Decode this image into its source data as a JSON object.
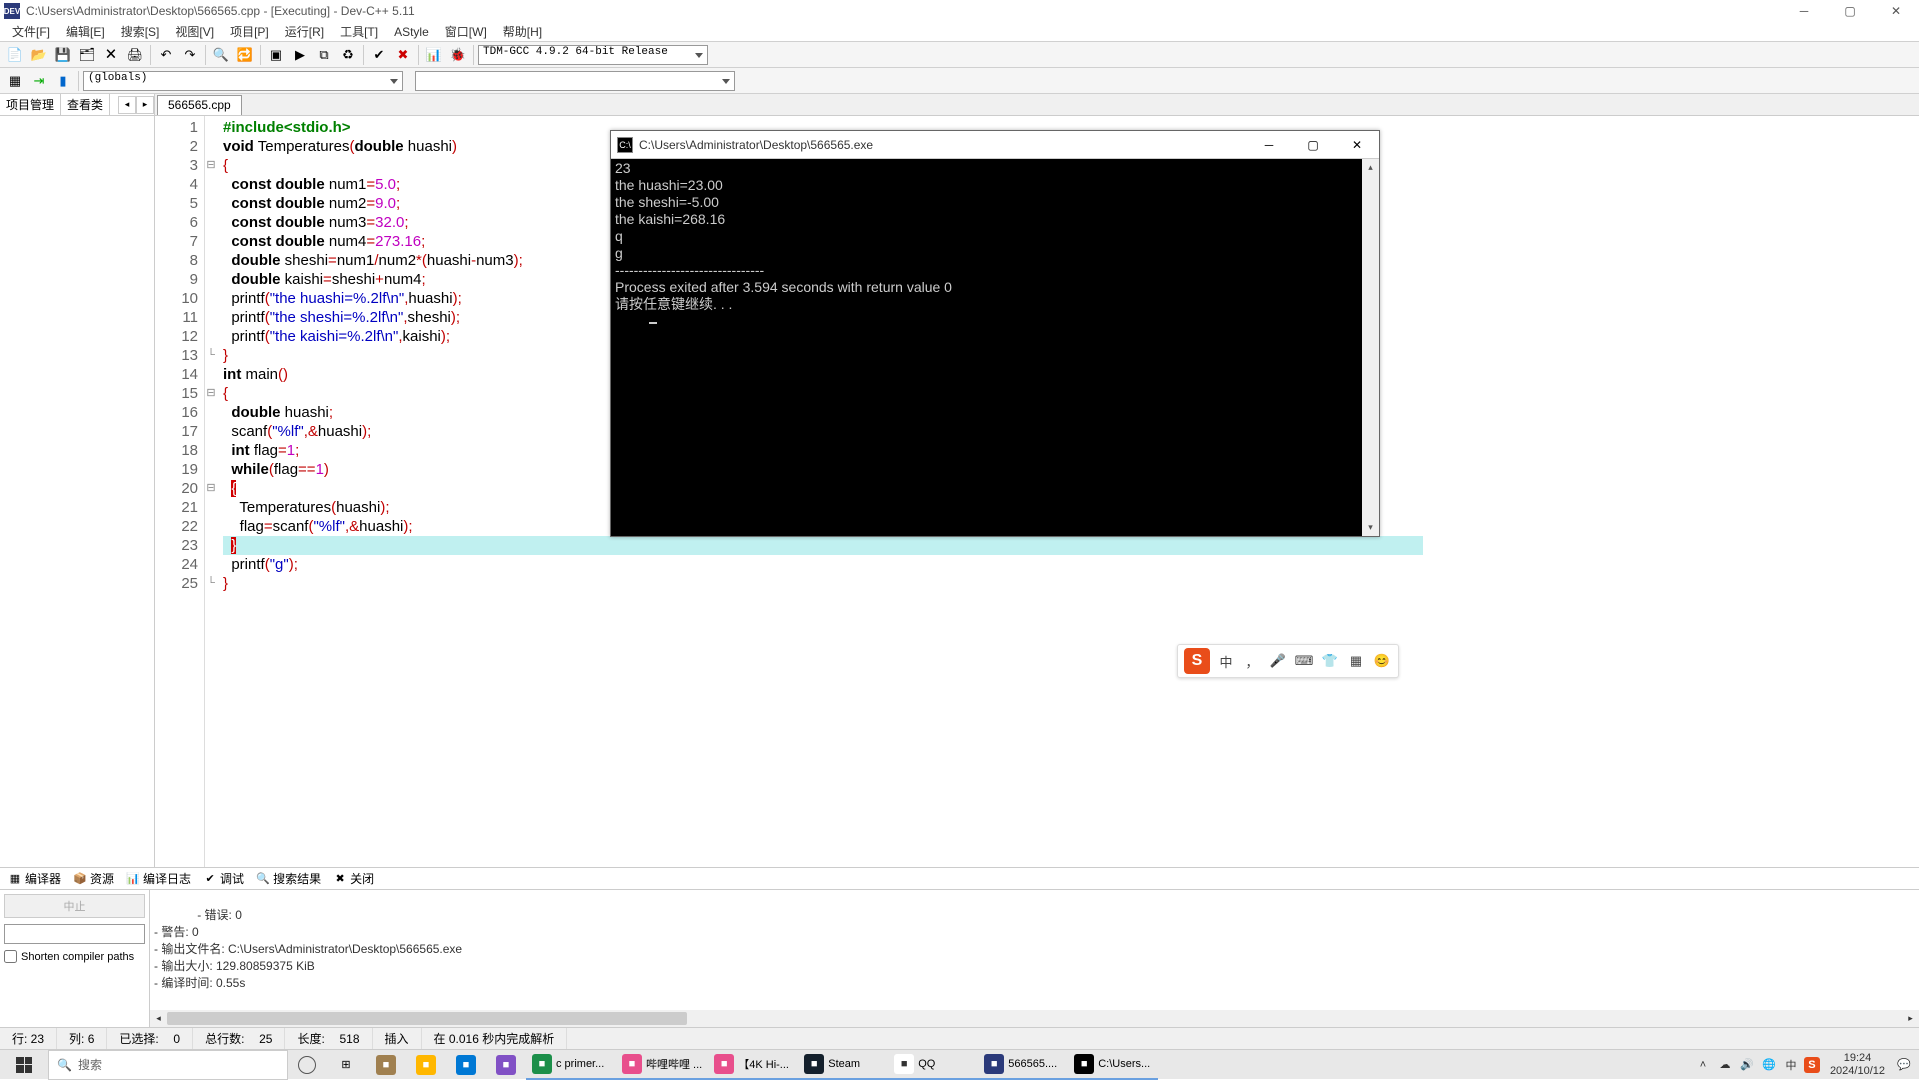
{
  "window": {
    "title": "C:\\Users\\Administrator\\Desktop\\566565.cpp - [Executing] - Dev-C++ 5.11"
  },
  "menus": [
    "文件[F]",
    "编辑[E]",
    "搜索[S]",
    "视图[V]",
    "项目[P]",
    "运行[R]",
    "工具[T]",
    "AStyle",
    "窗口[W]",
    "帮助[H]"
  ],
  "toolbar": {
    "globals": "(globals)",
    "compiler": "TDM-GCC 4.9.2 64-bit Release"
  },
  "sidebar": {
    "tabs": [
      "项目管理",
      "查看类"
    ]
  },
  "editor": {
    "tab": "566565.cpp",
    "lines": [
      {
        "n": 1,
        "fold": "",
        "t": [
          {
            "c": "pp",
            "s": "#include"
          },
          {
            "c": "pp",
            "s": "<stdio.h>"
          }
        ]
      },
      {
        "n": 2,
        "fold": "",
        "t": [
          {
            "c": "kw",
            "s": "void"
          },
          {
            "s": " Temperatures"
          },
          {
            "c": "pun",
            "s": "("
          },
          {
            "c": "kw",
            "s": "double"
          },
          {
            "s": " huashi"
          },
          {
            "c": "pun",
            "s": ")"
          }
        ]
      },
      {
        "n": 3,
        "fold": "⊟",
        "indent": 0,
        "t": [
          {
            "c": "pun",
            "s": "{"
          }
        ]
      },
      {
        "n": 4,
        "indent": 2,
        "t": [
          {
            "c": "kw",
            "s": "const"
          },
          {
            "s": " "
          },
          {
            "c": "kw",
            "s": "double"
          },
          {
            "s": " num1"
          },
          {
            "c": "pun",
            "s": "="
          },
          {
            "c": "num",
            "s": "5.0"
          },
          {
            "c": "pun",
            "s": ";"
          }
        ]
      },
      {
        "n": 5,
        "indent": 2,
        "t": [
          {
            "c": "kw",
            "s": "const"
          },
          {
            "s": " "
          },
          {
            "c": "kw",
            "s": "double"
          },
          {
            "s": " num2"
          },
          {
            "c": "pun",
            "s": "="
          },
          {
            "c": "num",
            "s": "9.0"
          },
          {
            "c": "pun",
            "s": ";"
          }
        ]
      },
      {
        "n": 6,
        "indent": 2,
        "t": [
          {
            "c": "kw",
            "s": "const"
          },
          {
            "s": " "
          },
          {
            "c": "kw",
            "s": "double"
          },
          {
            "s": " num3"
          },
          {
            "c": "pun",
            "s": "="
          },
          {
            "c": "num",
            "s": "32.0"
          },
          {
            "c": "pun",
            "s": ";"
          }
        ]
      },
      {
        "n": 7,
        "indent": 2,
        "t": [
          {
            "c": "kw",
            "s": "const"
          },
          {
            "s": " "
          },
          {
            "c": "kw",
            "s": "double"
          },
          {
            "s": " num4"
          },
          {
            "c": "pun",
            "s": "="
          },
          {
            "c": "num",
            "s": "273.16"
          },
          {
            "c": "pun",
            "s": ";"
          }
        ]
      },
      {
        "n": 8,
        "indent": 2,
        "t": [
          {
            "c": "kw",
            "s": "double"
          },
          {
            "s": " sheshi"
          },
          {
            "c": "pun",
            "s": "="
          },
          {
            "s": "num1"
          },
          {
            "c": "pun",
            "s": "/"
          },
          {
            "s": "num2"
          },
          {
            "c": "pun",
            "s": "*("
          },
          {
            "s": "huashi"
          },
          {
            "c": "pun",
            "s": "-"
          },
          {
            "s": "num3"
          },
          {
            "c": "pun",
            "s": ");"
          }
        ]
      },
      {
        "n": 9,
        "indent": 2,
        "t": [
          {
            "c": "kw",
            "s": "double"
          },
          {
            "s": " kaishi"
          },
          {
            "c": "pun",
            "s": "="
          },
          {
            "s": "sheshi"
          },
          {
            "c": "pun",
            "s": "+"
          },
          {
            "s": "num4"
          },
          {
            "c": "pun",
            "s": ";"
          }
        ]
      },
      {
        "n": 10,
        "indent": 2,
        "t": [
          {
            "s": "printf"
          },
          {
            "c": "pun",
            "s": "("
          },
          {
            "c": "str",
            "s": "\"the huashi=%.2lf\\n\""
          },
          {
            "c": "pun",
            "s": ","
          },
          {
            "s": "huashi"
          },
          {
            "c": "pun",
            "s": ");"
          }
        ]
      },
      {
        "n": 11,
        "indent": 2,
        "t": [
          {
            "s": "printf"
          },
          {
            "c": "pun",
            "s": "("
          },
          {
            "c": "str",
            "s": "\"the sheshi=%.2lf\\n\""
          },
          {
            "c": "pun",
            "s": ","
          },
          {
            "s": "sheshi"
          },
          {
            "c": "pun",
            "s": ");"
          }
        ]
      },
      {
        "n": 12,
        "indent": 2,
        "t": [
          {
            "s": "printf"
          },
          {
            "c": "pun",
            "s": "("
          },
          {
            "c": "str",
            "s": "\"the kaishi=%.2lf\\n\""
          },
          {
            "c": "pun",
            "s": ","
          },
          {
            "s": "kaishi"
          },
          {
            "c": "pun",
            "s": ");"
          }
        ]
      },
      {
        "n": 13,
        "fold": "└",
        "indent": 0,
        "t": [
          {
            "c": "pun",
            "s": "}"
          }
        ]
      },
      {
        "n": 14,
        "t": [
          {
            "c": "kw",
            "s": "int"
          },
          {
            "s": " main"
          },
          {
            "c": "pun",
            "s": "()"
          }
        ]
      },
      {
        "n": 15,
        "fold": "⊟",
        "indent": 0,
        "t": [
          {
            "c": "pun",
            "s": "{"
          }
        ]
      },
      {
        "n": 16,
        "indent": 2,
        "t": [
          {
            "c": "kw",
            "s": "double"
          },
          {
            "s": " huashi"
          },
          {
            "c": "pun",
            "s": ";"
          }
        ]
      },
      {
        "n": 17,
        "indent": 2,
        "t": [
          {
            "s": "scanf"
          },
          {
            "c": "pun",
            "s": "("
          },
          {
            "c": "str",
            "s": "\"%lf\""
          },
          {
            "c": "pun",
            "s": ",&"
          },
          {
            "s": "huashi"
          },
          {
            "c": "pun",
            "s": ");"
          }
        ]
      },
      {
        "n": 18,
        "indent": 2,
        "t": [
          {
            "c": "kw",
            "s": "int"
          },
          {
            "s": " flag"
          },
          {
            "c": "pun",
            "s": "="
          },
          {
            "c": "num",
            "s": "1"
          },
          {
            "c": "pun",
            "s": ";"
          }
        ]
      },
      {
        "n": 19,
        "indent": 2,
        "t": [
          {
            "c": "kw",
            "s": "while"
          },
          {
            "c": "pun",
            "s": "("
          },
          {
            "s": "flag"
          },
          {
            "c": "pun",
            "s": "=="
          },
          {
            "c": "num",
            "s": "1"
          },
          {
            "c": "pun",
            "s": ")"
          }
        ]
      },
      {
        "n": 20,
        "fold": "⊟",
        "indent": 2,
        "t": [
          {
            "c": "brace-hl",
            "s": "{"
          }
        ]
      },
      {
        "n": 21,
        "indent": 4,
        "t": [
          {
            "s": "Temperatures"
          },
          {
            "c": "pun",
            "s": "("
          },
          {
            "s": "huashi"
          },
          {
            "c": "pun",
            "s": ");"
          }
        ]
      },
      {
        "n": 22,
        "indent": 4,
        "t": [
          {
            "s": "flag"
          },
          {
            "c": "pun",
            "s": "="
          },
          {
            "s": "scanf"
          },
          {
            "c": "pun",
            "s": "("
          },
          {
            "c": "str",
            "s": "\"%lf\""
          },
          {
            "c": "pun",
            "s": ",&"
          },
          {
            "s": "huashi"
          },
          {
            "c": "pun",
            "s": ");"
          }
        ]
      },
      {
        "n": 23,
        "hl": true,
        "indent": 2,
        "t": [
          {
            "c": "brace-hl",
            "s": "}"
          }
        ]
      },
      {
        "n": 24,
        "indent": 2,
        "t": [
          {
            "s": "printf"
          },
          {
            "c": "pun",
            "s": "("
          },
          {
            "c": "str",
            "s": "\"g\""
          },
          {
            "c": "pun",
            "s": ");"
          }
        ]
      },
      {
        "n": 25,
        "fold": "└",
        "indent": 0,
        "t": [
          {
            "c": "pun",
            "s": "}"
          }
        ]
      }
    ]
  },
  "console": {
    "title": "C:\\Users\\Administrator\\Desktop\\566565.exe",
    "lines": [
      "23",
      "the huashi=23.00",
      "the sheshi=-5.00",
      "the kaishi=268.16",
      "q",
      "g",
      "--------------------------------",
      "Process exited after 3.594 seconds with return value 0",
      "请按任意键继续. . . "
    ]
  },
  "bottom": {
    "tabs": [
      "编译器",
      "资源",
      "编译日志",
      "调试",
      "搜索结果",
      "关闭"
    ],
    "stop": "中止",
    "shorten": "Shorten compiler paths",
    "log": "- 错误: 0\n- 警告: 0\n- 输出文件名: C:\\Users\\Administrator\\Desktop\\566565.exe\n- 输出大小: 129.80859375 KiB\n- 编译时间: 0.55s"
  },
  "status": {
    "line": "行: 23",
    "col": "列: 6",
    "sel_l": "已选择:",
    "sel_v": "0",
    "total_l": "总行数:",
    "total_v": "25",
    "len_l": "长度:",
    "len_v": "518",
    "mode": "插入",
    "parse": "在 0.016 秒内完成解析"
  },
  "ime": {
    "cn": "中"
  },
  "taskbar": {
    "search": "搜索",
    "items": [
      {
        "label": "",
        "color": "#a08050"
      },
      {
        "label": "",
        "color": "#ffb700"
      },
      {
        "label": "",
        "color": "#0078d4"
      },
      {
        "label": "",
        "color": "#8151c5"
      },
      {
        "label": "c primer...",
        "color": "#1c8f4a"
      },
      {
        "label": "哔哩哔哩 ...",
        "color": "#e84f8c"
      },
      {
        "label": "【4K Hi-...",
        "color": "#e84f8c"
      },
      {
        "label": "Steam",
        "color": "#14202c"
      },
      {
        "label": "QQ",
        "color": "#fff",
        "fg": "#333"
      },
      {
        "label": "566565....",
        "color": "#2b3a7a"
      },
      {
        "label": "C:\\Users...",
        "color": "#000"
      }
    ],
    "cn": "中",
    "sogou": "S",
    "time": "19:24",
    "date": "2024/10/12"
  }
}
